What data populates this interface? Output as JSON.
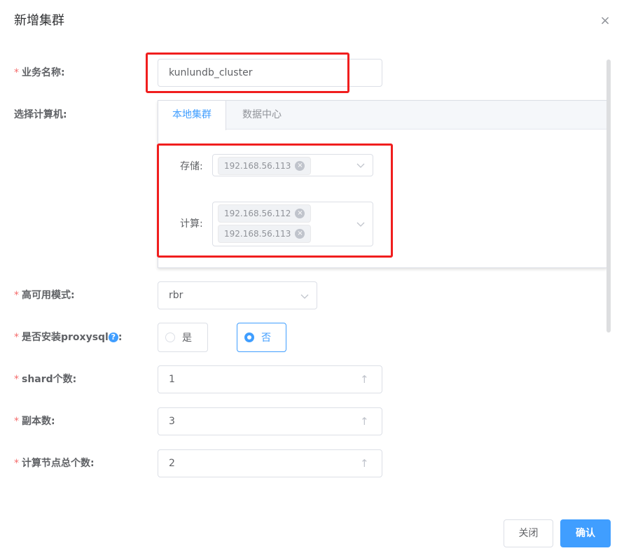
{
  "dialog": {
    "title": "新增集群",
    "close_glyph": "×"
  },
  "form": {
    "required_mark": "*",
    "business_name": {
      "label": "业务名称:",
      "value": "kunlundb_cluster"
    },
    "select_machine": {
      "label": "选择计算机:",
      "tabs": [
        {
          "label": "本地集群",
          "active": true
        },
        {
          "label": "数据中心",
          "active": false
        }
      ],
      "storage": {
        "label": "存储:",
        "tags": [
          "192.168.56.113"
        ]
      },
      "compute": {
        "label": "计算:",
        "tags": [
          "192.168.56.112",
          "192.168.56.113"
        ]
      }
    },
    "ha_mode": {
      "label": "高可用模式:",
      "value": "rbr"
    },
    "proxysql": {
      "label": "是否安装proxysql",
      "help_glyph": "?",
      "colon": ":",
      "options": [
        {
          "label": "是",
          "checked": false
        },
        {
          "label": "否",
          "checked": true
        }
      ]
    },
    "shard_count": {
      "label": "shard个数:",
      "value": "1"
    },
    "replica_count": {
      "label": "副本数:",
      "value": "3"
    },
    "compute_nodes": {
      "label": "计算节点总个数:",
      "value": "2"
    }
  },
  "footer": {
    "close_label": "关闭",
    "confirm_label": "确认"
  },
  "icons": {
    "tag_remove": "×",
    "chevron": "chevron-down-icon",
    "stepper_up": "↑"
  },
  "colors": {
    "accent": "#409eff",
    "required": "#f56c6c",
    "highlight_box": "#f01e1e"
  }
}
